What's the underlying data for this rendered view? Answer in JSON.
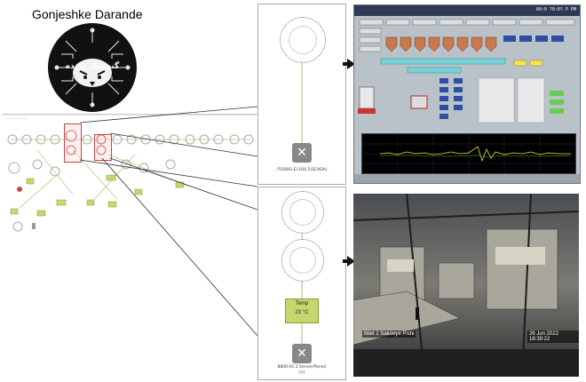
{
  "header": {
    "title": "Gonjeshke Darande",
    "logo_text": "گنجشک درنده"
  },
  "network_map": {
    "header_text": "··· ····· ··· ····"
  },
  "zoom_top": {
    "caption": "?5500G-EI-104.1(SCADA)"
  },
  "zoom_bottom": {
    "temp_label": "Temp",
    "temp_value": "23 °C",
    "caption_line1": "8800-01.1 Server(Panel)",
    "caption_line2": "???"
  },
  "scada": {
    "header_text": "00:0 ?0:0? P PM"
  },
  "camera": {
    "location_label": "Bilet 1 Sakooye Pishi",
    "timestamp": "26 Jun 2022  18:39:22"
  },
  "colors": {
    "logo_bg": "#111111",
    "highlight": "#cc4444",
    "temp_box": "#c5d86d",
    "scada_bg": "#b9c2c9",
    "trend_bg": "#000000"
  }
}
